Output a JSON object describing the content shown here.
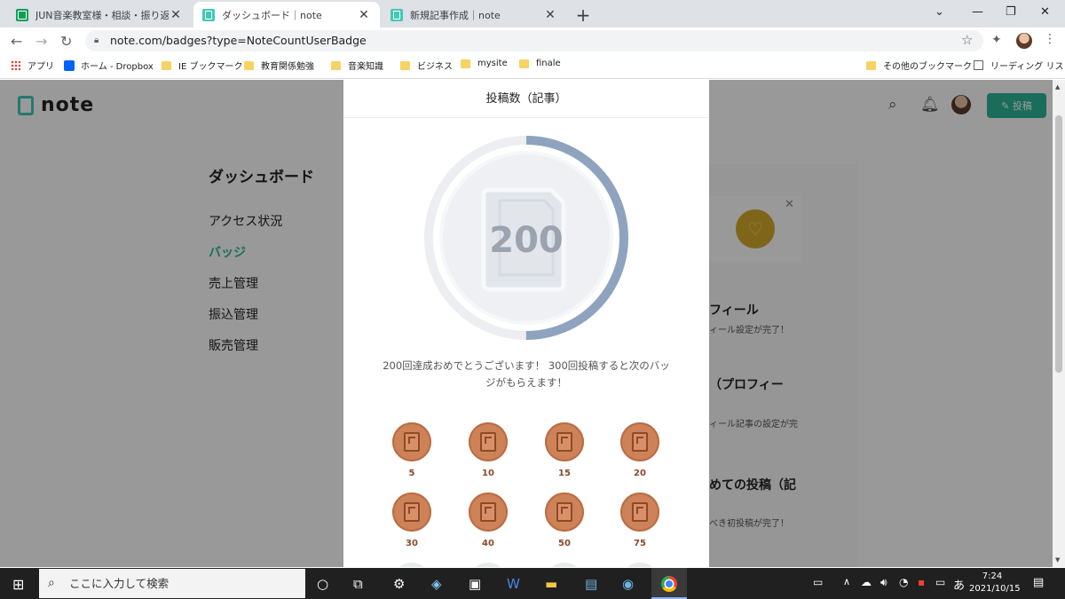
{
  "browser": {
    "tabs": [
      {
        "title": "JUN音楽教室様・相談・振り返りシー",
        "icon": "sheets-icon",
        "active": false
      },
      {
        "title": "ダッシュボード｜note",
        "icon": "note-icon",
        "active": true
      },
      {
        "title": "新規記事作成｜note",
        "icon": "note-icon",
        "active": false
      }
    ],
    "url": "note.com/badges?type=NoteCountUserBadge",
    "bookmarks": [
      "アプリ",
      "ホーム - Dropbox",
      "IE ブックマーク",
      "教育関係勉強",
      "音楽知識",
      "ビジネス",
      "mysite",
      "finale"
    ],
    "bookmarks_right": [
      "その他のブックマーク",
      "リーディング リスト"
    ]
  },
  "note": {
    "post_button": "投稿",
    "dashboard_title": "ダッシュボード",
    "sidebar": [
      {
        "label": "アクセス状況",
        "selected": false
      },
      {
        "label": "バッジ",
        "selected": true
      },
      {
        "label": "売上管理",
        "selected": false
      },
      {
        "label": "振込管理",
        "selected": false
      },
      {
        "label": "販売管理",
        "selected": false
      }
    ],
    "right_column": [
      {
        "title": "フィール",
        "sub": "ィール設定が完了！"
      },
      {
        "title": "（プロフィー",
        "sub": "ィール記事の設定が完"
      },
      {
        "title": "めての投稿（記",
        "sub": "べき初投稿が完了！"
      }
    ]
  },
  "modal": {
    "title": "投稿数（記事）",
    "current_badge": "200",
    "progress": 0.5,
    "message": "200回達成おめでとうございます！ 300回投稿すると次のバッジがもらえます！",
    "badges": [
      "5",
      "10",
      "15",
      "20",
      "30",
      "40",
      "50",
      "75"
    ]
  },
  "taskbar": {
    "search_placeholder": "ここに入力して検索",
    "time": "7:24",
    "date": "2021/10/15",
    "ime": "あ"
  },
  "colors": {
    "accent": "#2cb696",
    "progress": "#8fa3bf",
    "bronze": "#cd8258"
  }
}
